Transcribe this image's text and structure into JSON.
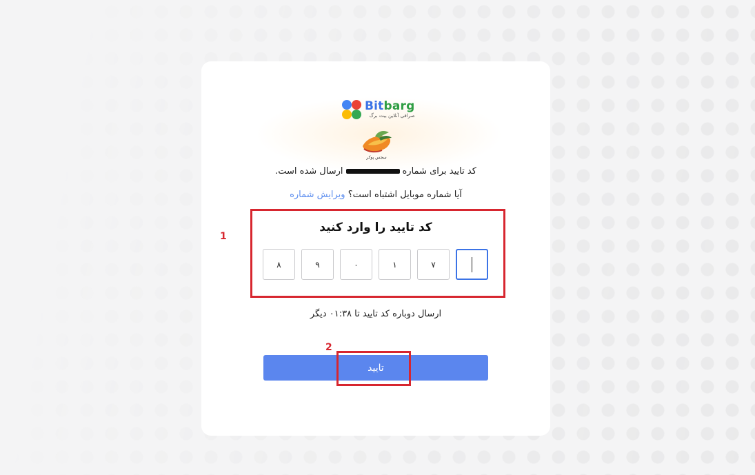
{
  "brand": {
    "name_part1": "Bit",
    "name_part2": "barg",
    "subtitle": "صرافی آنلاین بیت برگ",
    "logo_colors": [
      "#4285f4",
      "#ea4335",
      "#fbbc05",
      "#34a853"
    ],
    "partner_label": "سجس پوکر"
  },
  "message": {
    "sent_prefix": "کد تایید برای شماره",
    "sent_suffix": "ارسال شده است.",
    "wrong_number_question": "آیا شماره موبایل اشتباه است؟",
    "edit_number_link": "ویرایش شماره"
  },
  "verification": {
    "title": "کد تایید را وارد کنید",
    "digits": [
      "",
      "۷",
      "۱",
      "۰",
      "۹",
      "۸"
    ]
  },
  "resend": {
    "text": "ارسال دوباره کد تایید تا ۰۱:۳۸ دیگر"
  },
  "submit": {
    "label": "تایید"
  },
  "annotations": {
    "label1": "1",
    "label2": "2",
    "color": "#d7262f"
  },
  "colors": {
    "accent": "#5b86ee",
    "link": "#5b8def",
    "active_border": "#3b73e6"
  }
}
